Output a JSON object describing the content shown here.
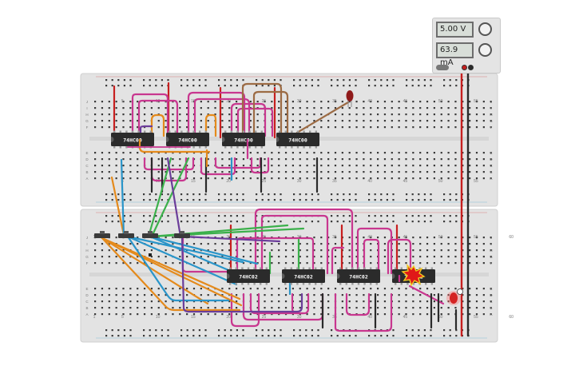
{
  "power_supply": {
    "voltage_readout": "5.00 V",
    "current_readout": "63.9 mA"
  },
  "chips": {
    "top": [
      "74HC00",
      "74HC00",
      "74HC00",
      "74HC00"
    ],
    "bottom": [
      "74HC02",
      "74HC02",
      "74HC02",
      "74HC02"
    ]
  },
  "breadboard_top": {
    "column_numbers": [
      "5",
      "10",
      "15",
      "20",
      "25",
      "30",
      "35",
      "40",
      "45",
      "50",
      "55"
    ],
    "row_letters": [
      "J",
      "I",
      "H",
      "G",
      "F",
      "E",
      "D",
      "C",
      "B",
      "A"
    ]
  },
  "breadboard_bottom": {
    "column_numbers": [
      "1",
      "5",
      "10",
      "15",
      "20",
      "25",
      "30",
      "35",
      "40",
      "45",
      "50",
      "55",
      "60"
    ],
    "row_letters": [
      "J",
      "I",
      "H",
      "G",
      "F",
      "E",
      "D",
      "C",
      "B",
      "A"
    ]
  },
  "colors": {
    "board": "#e3e3e3",
    "chip": "#2b2b2b",
    "wire_magenta": "#c8378f",
    "wire_orange": "#e48a1c",
    "wire_blue": "#2a95c9",
    "wire_green": "#3bb04b",
    "wire_purple": "#6b3d9a",
    "wire_brown": "#9c6b44",
    "wire_red": "#c71f1f",
    "wire_black": "#2a2a2a",
    "led_red": "#d42424",
    "led_dark_red": "#8f1a1a"
  }
}
